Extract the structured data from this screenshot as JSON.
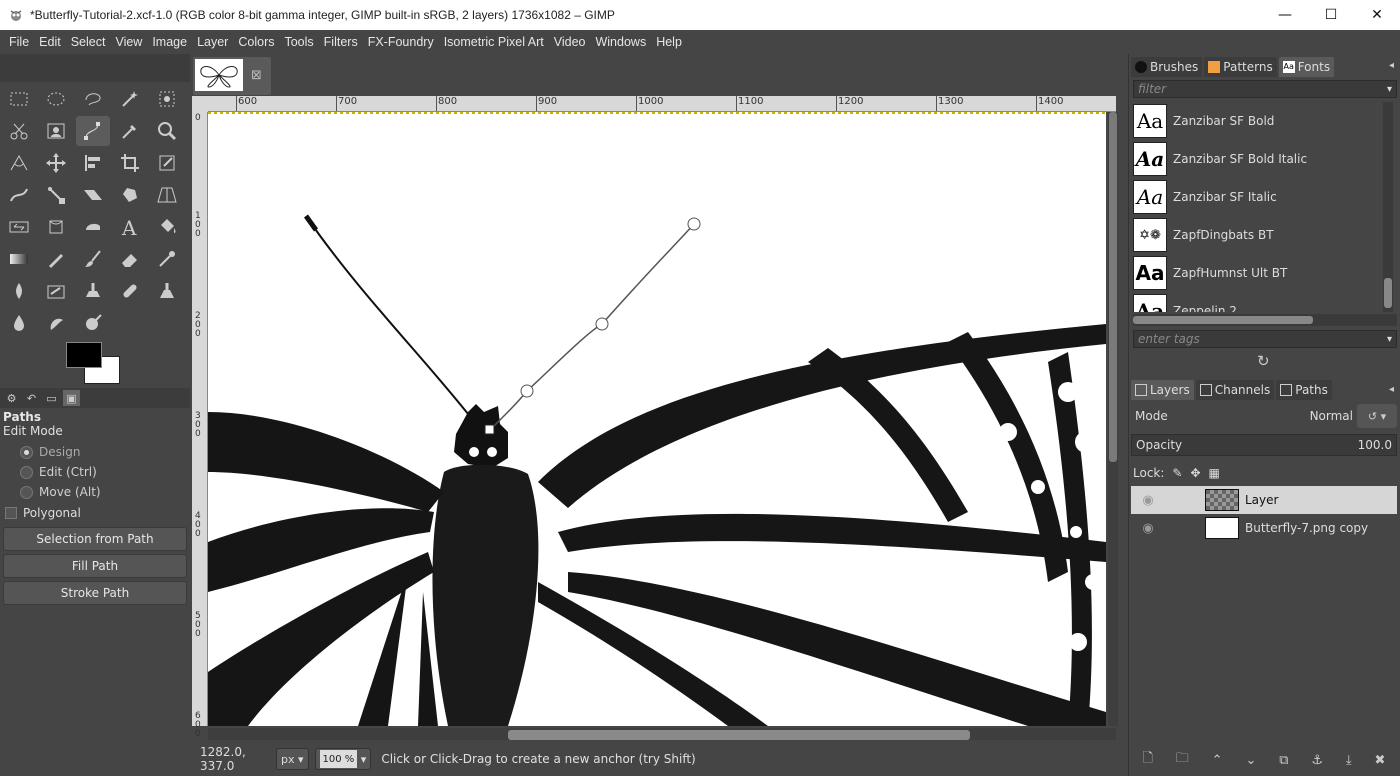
{
  "window": {
    "title": "*Butterfly-Tutorial-2.xcf-1.0 (RGB color 8-bit gamma integer, GIMP built-in sRGB, 2 layers) 1736x1082 – GIMP",
    "minimize": "—",
    "maximize": "☐",
    "close": "✕"
  },
  "menu": [
    "File",
    "Edit",
    "Select",
    "View",
    "Image",
    "Layer",
    "Colors",
    "Tools",
    "Filters",
    "FX-Foundry",
    "Isometric Pixel Art",
    "Video",
    "Windows",
    "Help"
  ],
  "tool_options": {
    "title": "Paths",
    "edit_mode_label": "Edit Mode",
    "modes": [
      {
        "label": "Design",
        "selected": true
      },
      {
        "label": "Edit (Ctrl)",
        "selected": false
      },
      {
        "label": "Move (Alt)",
        "selected": false
      }
    ],
    "polygonal_label": "Polygonal",
    "buttons": [
      "Selection from Path",
      "Fill Path",
      "Stroke Path"
    ]
  },
  "ruler": {
    "h_labels": [
      "600",
      "700",
      "800",
      "900",
      "1000",
      "1100",
      "1200",
      "1300",
      "1400"
    ],
    "v_labels": [
      "0",
      "100",
      "200",
      "300",
      "400",
      "500",
      "600"
    ]
  },
  "status": {
    "coords": "1282.0, 337.0",
    "unit": "px",
    "zoom": "100 %",
    "message": "Click or Click-Drag to create a new anchor (try Shift)"
  },
  "fonts_panel": {
    "tabs": [
      "Brushes",
      "Patterns",
      "Fonts"
    ],
    "filter_placeholder": "filter",
    "fonts": [
      {
        "preview": "Aa",
        "name": "Zanzibar SF Bold"
      },
      {
        "preview": "Aa",
        "name": "Zanzibar SF Bold Italic"
      },
      {
        "preview": "Aa",
        "name": "Zanzibar SF Italic"
      },
      {
        "preview": "✡❁",
        "name": "ZapfDingbats BT"
      },
      {
        "preview": "Aa",
        "name": "ZapfHumnst Ult BT"
      },
      {
        "preview": "Aa",
        "name": "Zeppelin 2"
      }
    ],
    "tags_placeholder": "enter tags"
  },
  "layers_panel": {
    "tabs": [
      "Layers",
      "Channels",
      "Paths"
    ],
    "mode_label": "Mode",
    "mode_value": "Normal",
    "opacity_label": "Opacity",
    "opacity_value": "100.0",
    "lock_label": "Lock:",
    "layers": [
      {
        "name": "Layer",
        "selected": true
      },
      {
        "name": "Butterfly-7.png copy",
        "selected": false
      }
    ]
  },
  "colors": {
    "foreground": "#000000",
    "background": "#ffffff",
    "ui_bg": "#454545"
  }
}
